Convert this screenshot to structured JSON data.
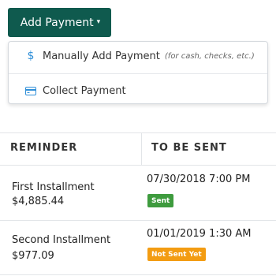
{
  "add_payment_button": {
    "label": "Add Payment",
    "caret": "▾"
  },
  "dropdown": {
    "items": [
      {
        "icon": "dollar-icon",
        "glyph": "$",
        "label": "Manually Add Payment",
        "note": "(for cash, checks, etc.)"
      },
      {
        "icon": "credit-card-icon",
        "label": "Collect Payment"
      }
    ]
  },
  "table": {
    "columns": [
      "REMINDER",
      "TO BE SENT"
    ],
    "rows": [
      {
        "name": "First Installment",
        "amount": "$4,885.44",
        "date": "07/30/2018 7:00 PM",
        "status": "Sent",
        "status_color": "#3e9b3e"
      },
      {
        "name": "Second Installment",
        "amount": "$977.09",
        "date": "01/01/2019 1:30 AM",
        "status": "Not Sent Yet",
        "status_color": "#f39c12"
      }
    ]
  },
  "colors": {
    "primary_button": "#0f5a4e",
    "icon_blue": "#2f8fd8"
  }
}
